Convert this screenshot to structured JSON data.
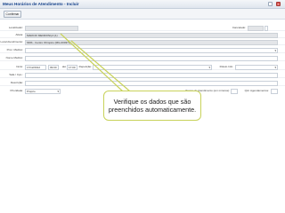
{
  "window": {
    "title": "Meus Horários de Atendimento - Incluir"
  },
  "toolbar": {
    "confirm_label": "Confirmar"
  },
  "form": {
    "localizador": {
      "label": "Localizador:",
      "value": ""
    },
    "cancelado": {
      "label": "Cancelado:",
      "value": ""
    },
    "atletas": {
      "label": "Atleta:",
      "value": "MARCIO MENDONÇA (1)"
    },
    "local": {
      "label": "Local Atendimento:",
      "value": "SMS - Centro Olímpico (MG-000371)"
    },
    "proc_medico": {
      "label": "Proc. Médico:",
      "value": ""
    },
    "nome_medico": {
      "label": "Nome Médico:",
      "value": ""
    },
    "inicio": {
      "label": "Início:",
      "date": "17/12/2012",
      "time": "09:00",
      "ate_label": "até",
      "end_time": "17:00",
      "repeticao_label": "Repetição:",
      "repeticao_value": "",
      "rotulo_label": "Rótulo Info:",
      "rotulo_value": ""
    },
    "sala": {
      "label": "Sala / Cpo.:",
      "value": ""
    },
    "descricao": {
      "label": "Descrição:",
      "value": ""
    },
    "prioridade": {
      "label": "Prioridade:",
      "value": "Próprio",
      "tempo_label": "Tempo de Atendimento (em minutos):",
      "tempo_value": "",
      "qtd_label": "Qtd. Agendamentos:",
      "qtd_value": ""
    }
  },
  "callout": {
    "text": "Verifique os dados que são preenchidos automaticamente."
  },
  "colors": {
    "accent": "#15428b",
    "callout_border": "#c8d25a"
  }
}
